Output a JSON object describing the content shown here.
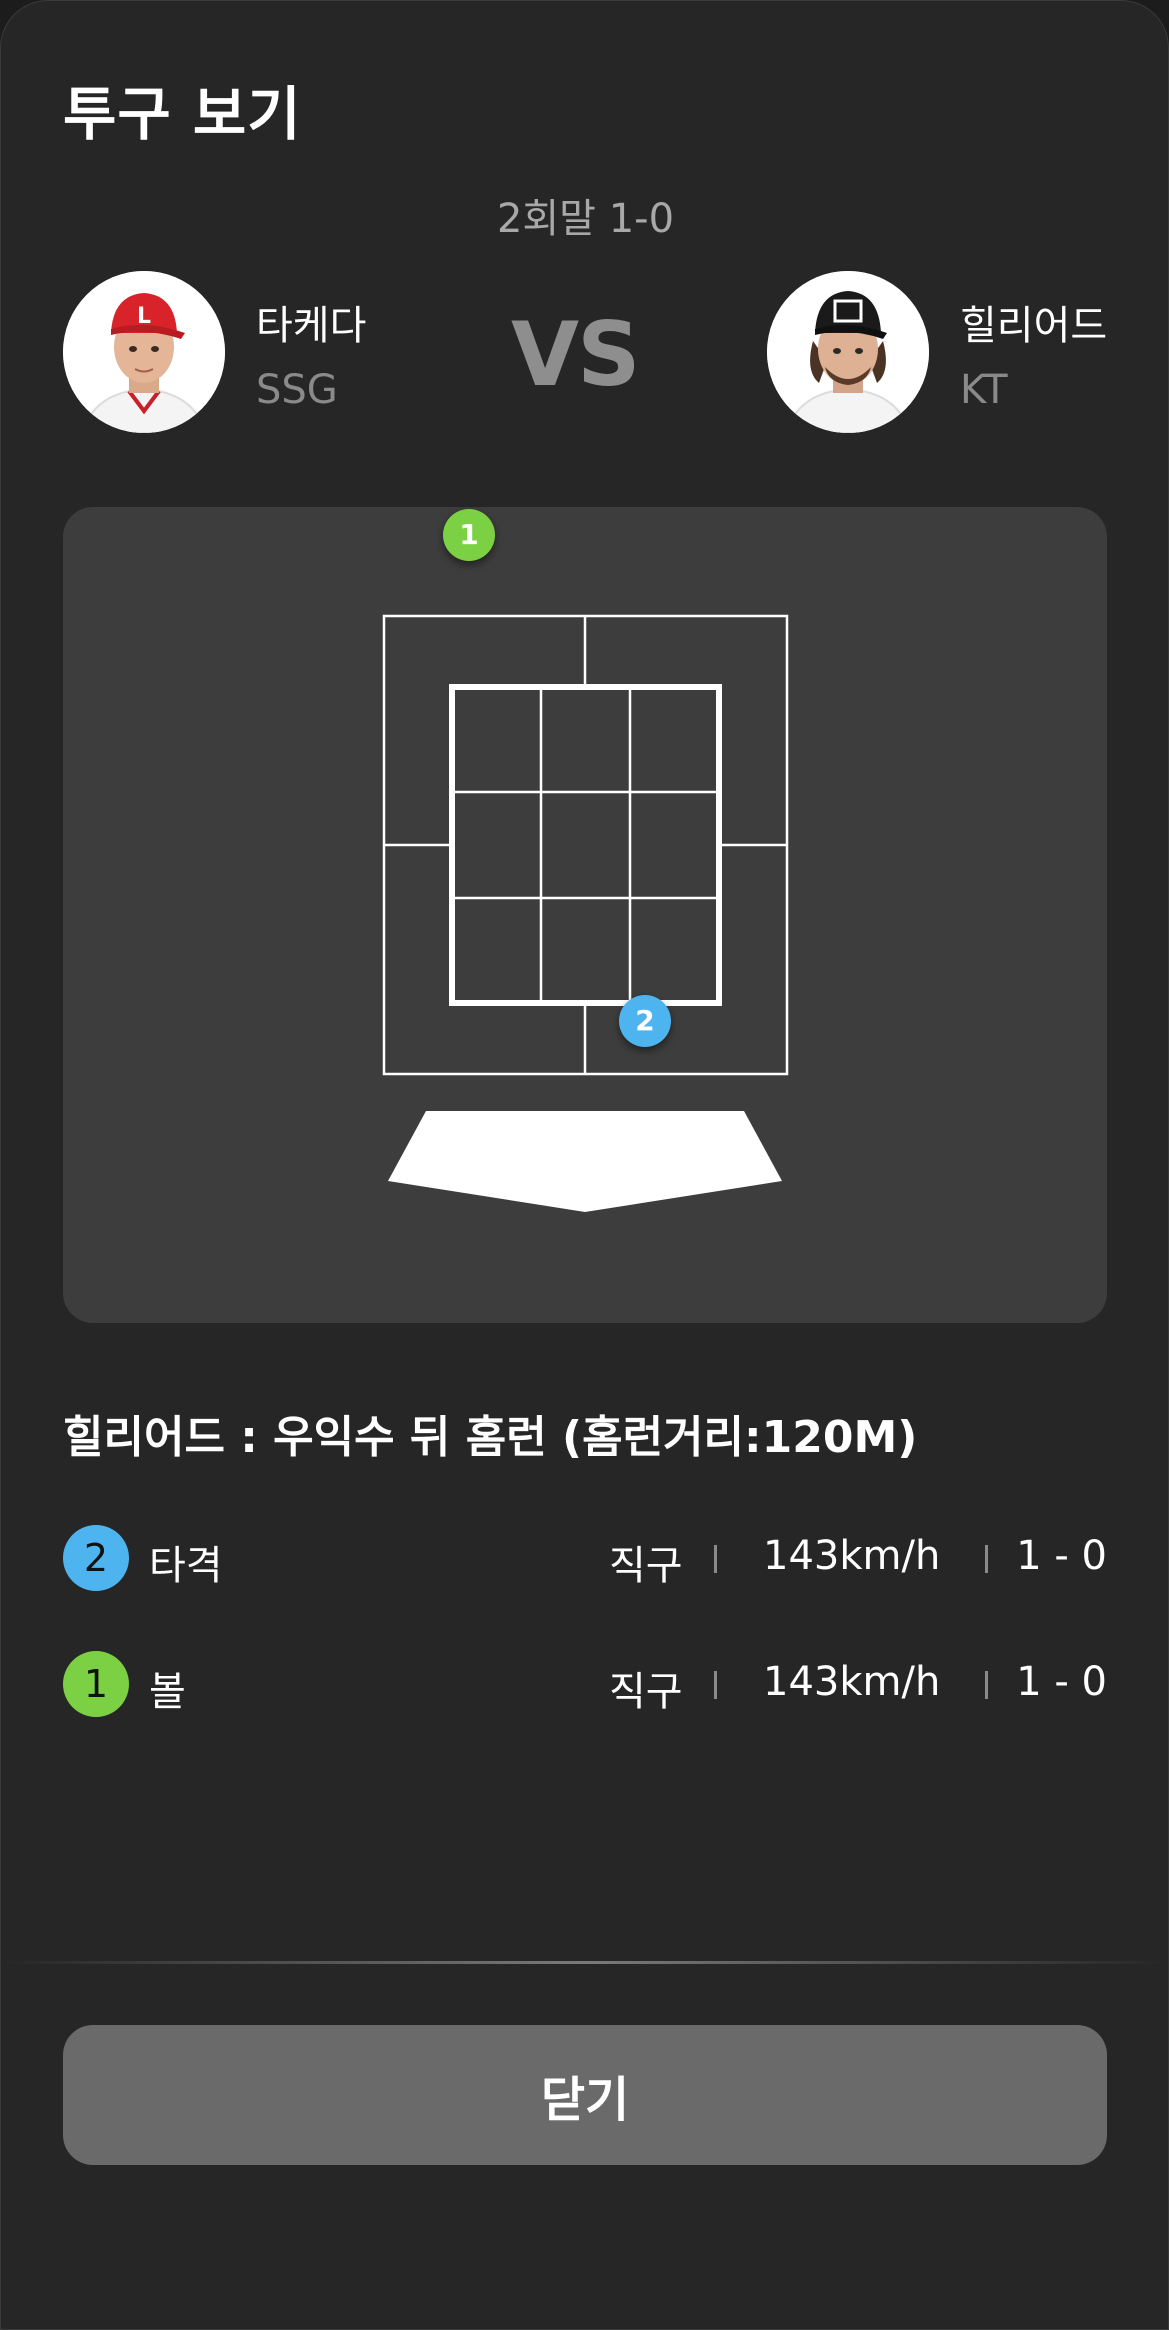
{
  "header": {
    "title": "투구 보기",
    "inning": "2회말 1-0",
    "vs_label": "VS"
  },
  "pitcher": {
    "name": "타케다",
    "team": "SSG",
    "cap_color": "#d8232a"
  },
  "batter": {
    "name": "힐리어드",
    "team": "KT",
    "cap_color": "#1a1a1a"
  },
  "strike_zone": {
    "pitches": [
      {
        "number": "1",
        "result": "볼",
        "color": "#7bd143"
      },
      {
        "number": "2",
        "result": "타격",
        "color": "#4db4f0"
      }
    ]
  },
  "result_summary": "힐리어드 : 우익수 뒤 홈런 (홈런거리:120M)",
  "pitch_list": [
    {
      "number": "2",
      "label": "타격",
      "pitch_type": "직구",
      "speed": "143km/h",
      "count": "1 - 0",
      "color": "#4db4f0"
    },
    {
      "number": "1",
      "label": "볼",
      "pitch_type": "직구",
      "speed": "143km/h",
      "count": "1 - 0",
      "color": "#7bd143"
    }
  ],
  "footer": {
    "close_label": "닫기"
  },
  "colors": {
    "background": "#262626",
    "panel": "#3d3d3d",
    "button": "#6a6a6a",
    "text_muted": "#8a8a8a"
  }
}
